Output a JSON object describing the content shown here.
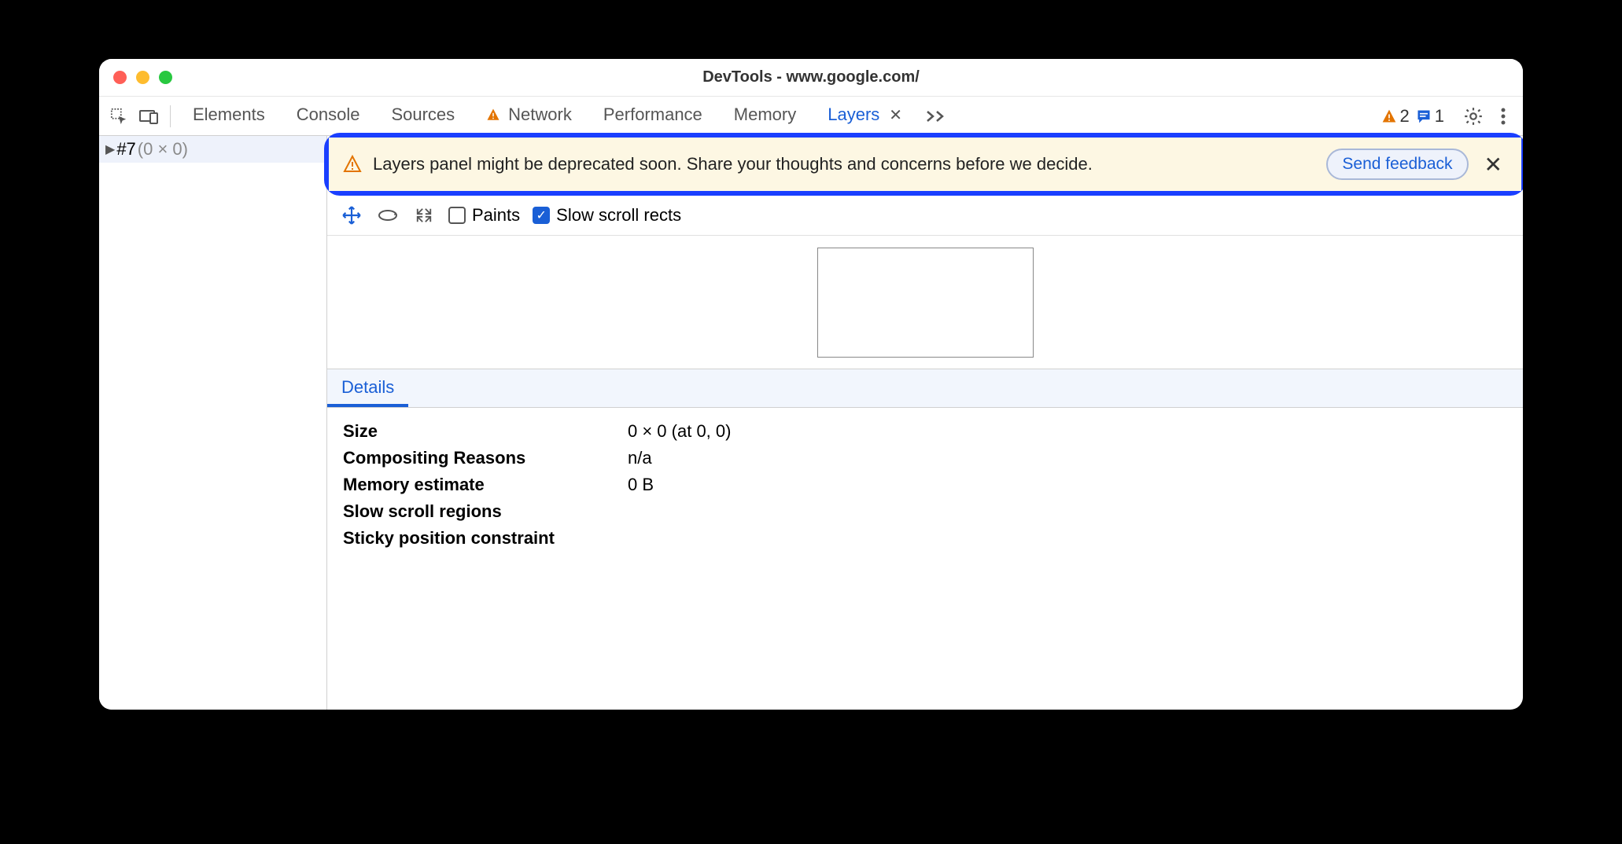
{
  "window": {
    "title": "DevTools - www.google.com/"
  },
  "tabs": {
    "elements": "Elements",
    "console": "Console",
    "sources": "Sources",
    "network": "Network",
    "performance": "Performance",
    "memory": "Memory",
    "layers": "Layers"
  },
  "counts": {
    "warnings": "2",
    "messages": "1"
  },
  "sidebar": {
    "item0": {
      "label": "#7",
      "dim": "(0 × 0)"
    }
  },
  "banner": {
    "text": "Layers panel might be deprecated soon. Share your thoughts and concerns before we decide.",
    "button": "Send feedback"
  },
  "layer_toolbar": {
    "paints": "Paints",
    "slow_rects": "Slow scroll rects"
  },
  "details": {
    "tab": "Details",
    "rows": {
      "size_k": "Size",
      "size_v": "0 × 0 (at 0, 0)",
      "comp_k": "Compositing Reasons",
      "comp_v": "n/a",
      "mem_k": "Memory estimate",
      "mem_v": "0 B",
      "slow_k": "Slow scroll regions",
      "slow_v": "",
      "sticky_k": "Sticky position constraint",
      "sticky_v": ""
    }
  }
}
